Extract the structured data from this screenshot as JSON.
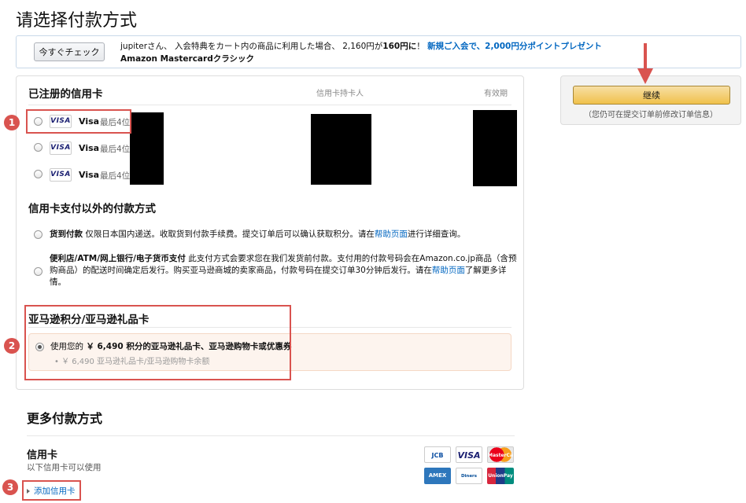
{
  "page": {
    "title": "请选择付款方式"
  },
  "promo": {
    "button_label": "今すぐチェック",
    "line1_a": "jupiterさん、 入会特典をカート内の商品に利用した場合、 2,160円が",
    "line1_b": "160円に",
    "line1_c": "！ ",
    "line1_link": "新規ご入会で、2,000円分ポイントプレゼント",
    "line2": "Amazon Mastercardクラシック"
  },
  "registered": {
    "title": "已注册的信用卡",
    "col_holder": "信用卡持卡人",
    "col_expiry": "有效期",
    "cards": [
      {
        "logo": "VISA",
        "brand": "Visa",
        "last4_label": "最后4位"
      },
      {
        "logo": "VISA",
        "brand": "Visa",
        "last4_label": "最后4位"
      },
      {
        "logo": "VISA",
        "brand": "Visa",
        "last4_label": "最后4位"
      }
    ]
  },
  "other": {
    "title": "信用卡支付以外的付款方式",
    "cod_name": "货到付款",
    "cod_text": " 仅限日本国内递送。收取货到付款手续费。提交订单后可以确认获取积分。请在",
    "cod_link": "帮助页面",
    "cod_tail": "进行详细查询。",
    "conv_name": "便利店/ATM/网上银行/电子货币支付",
    "conv_text1": " 此支付方式会要求您在我们发货前付款。支付用的付款号码会在Amazon.co.jp商品（含预",
    "conv_text2": "购商品）的配送时间确定后发行。购买亚马逊商城的卖家商品，付款号码在提交订单30分钟后发行。请在",
    "conv_link": "帮助页面",
    "conv_tail": "了解更多详",
    "conv_text3": "情。"
  },
  "gift": {
    "title": "亚马逊积分/亚马逊礼品卡",
    "use_prefix": "使用您的 ",
    "use_bold": "￥ 6,490 积分的亚马逊礼品卡、亚马逊购物卡或优惠券",
    "balance": "•  ￥ 6,490 亚马逊礼品卡/亚马逊购物卡余额"
  },
  "continue": {
    "button_label": "继续",
    "note": "（您仍可在提交订单前修改订单信息）"
  },
  "more": {
    "title": "更多付款方式",
    "cc_title": "信用卡",
    "cc_sub": "以下信用卡可以使用",
    "add_link": "添加信用卡",
    "logos": [
      "JCB",
      "VISA",
      "MasterCard",
      "AMEX",
      "Diners Club",
      "UnionPay"
    ]
  },
  "annotations": [
    "1",
    "2",
    "3"
  ],
  "colors": {
    "link": "#0066c0",
    "annotation": "#d9534f",
    "continue_button": "#f0c14b"
  }
}
